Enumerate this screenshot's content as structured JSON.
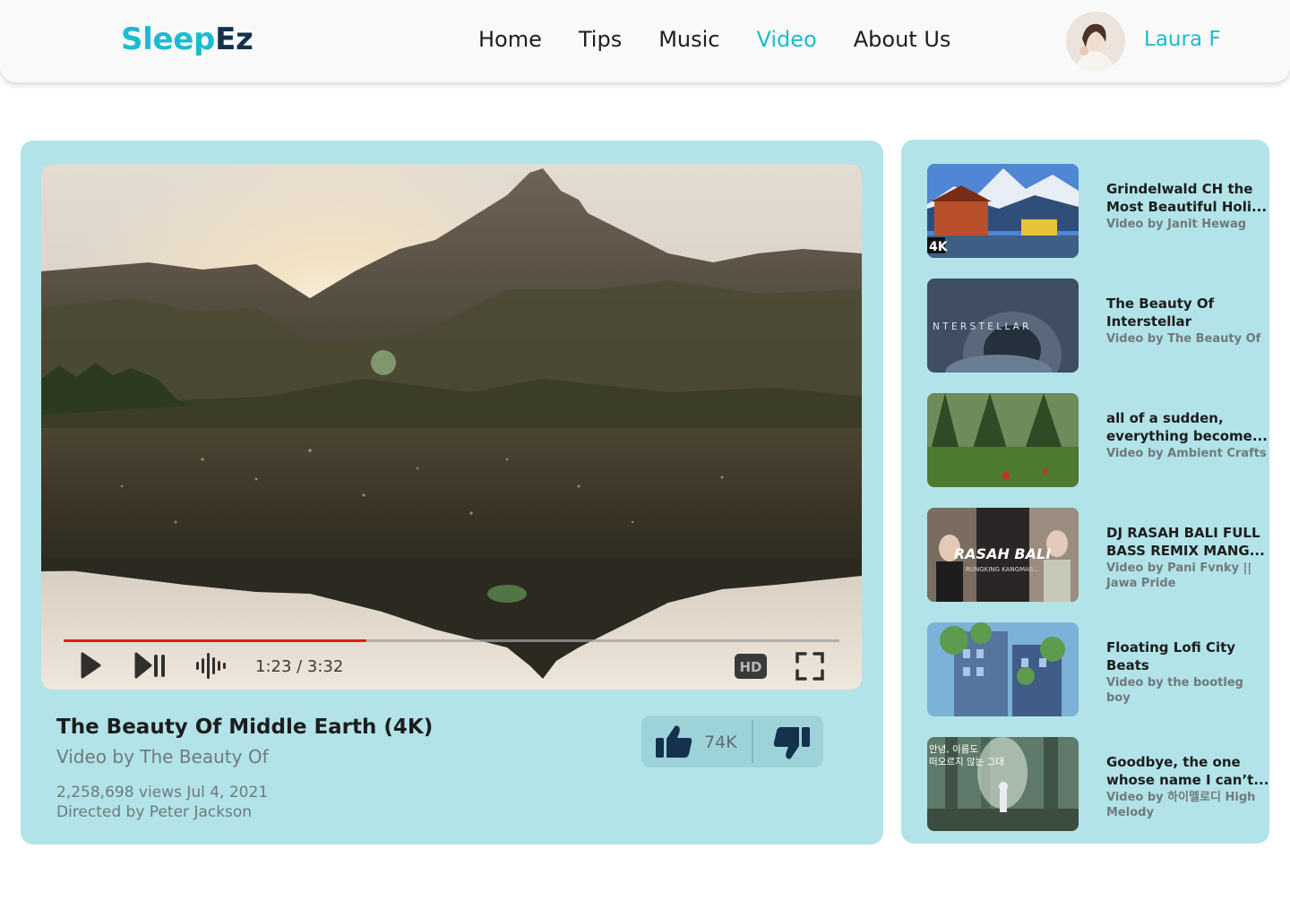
{
  "header": {
    "logo_part1": "Sleep",
    "logo_part2": "Ez",
    "nav": [
      {
        "label": "Home",
        "active": false
      },
      {
        "label": "Tips",
        "active": false
      },
      {
        "label": "Music",
        "active": false
      },
      {
        "label": "Video",
        "active": true
      },
      {
        "label": "About Us",
        "active": false
      }
    ],
    "user_name": "Laura F"
  },
  "player": {
    "time": "1:23 / 3:32",
    "progress_fraction": 0.39,
    "hd_label": "HD",
    "icons": [
      "play-icon",
      "next-icon",
      "volume-icon",
      "hd-icon",
      "fullscreen-icon"
    ]
  },
  "video": {
    "title": "The Beauty Of Middle Earth (4K)",
    "channel": "Video by The Beauty Of",
    "views_date": "2,258,698 views  Jul 4, 2021",
    "director": "Directed by Peter Jackson",
    "likes": "74K"
  },
  "recommendations": [
    {
      "title": "Grindelwald CH the Most Beautiful Holi...",
      "channel": "Video by Janit Hewag",
      "thumb_text": "4K"
    },
    {
      "title": "The Beauty Of Interstellar",
      "channel": "Video by The Beauty Of",
      "thumb_text": "N T E R S T E L L A R"
    },
    {
      "title": "all of a sudden, everything become...",
      "channel": "Video by Ambient Crafts"
    },
    {
      "title": "DJ RASAH BALI FULL BASS REMIX MANG...",
      "channel": "Video by Pani Fvnky || Jawa Pride",
      "thumb_text": "RASAH BALI",
      "thumb_subtext": "RUNGKING KANGMAS..."
    },
    {
      "title": "Floating Lofi City Beats",
      "channel": "Video by the bootleg boy"
    },
    {
      "title": "Goodbye, the one whose name I can’t...",
      "channel": "Video by 하이멜로디 High Melody",
      "thumb_text": "안녕, 이름도\n떠오르지 않는 그대"
    }
  ],
  "colors": {
    "accent": "#1bbcd0",
    "logo_dark": "#14314d",
    "card_bg": "#b1e3e8",
    "progress": "#e01b1b"
  }
}
